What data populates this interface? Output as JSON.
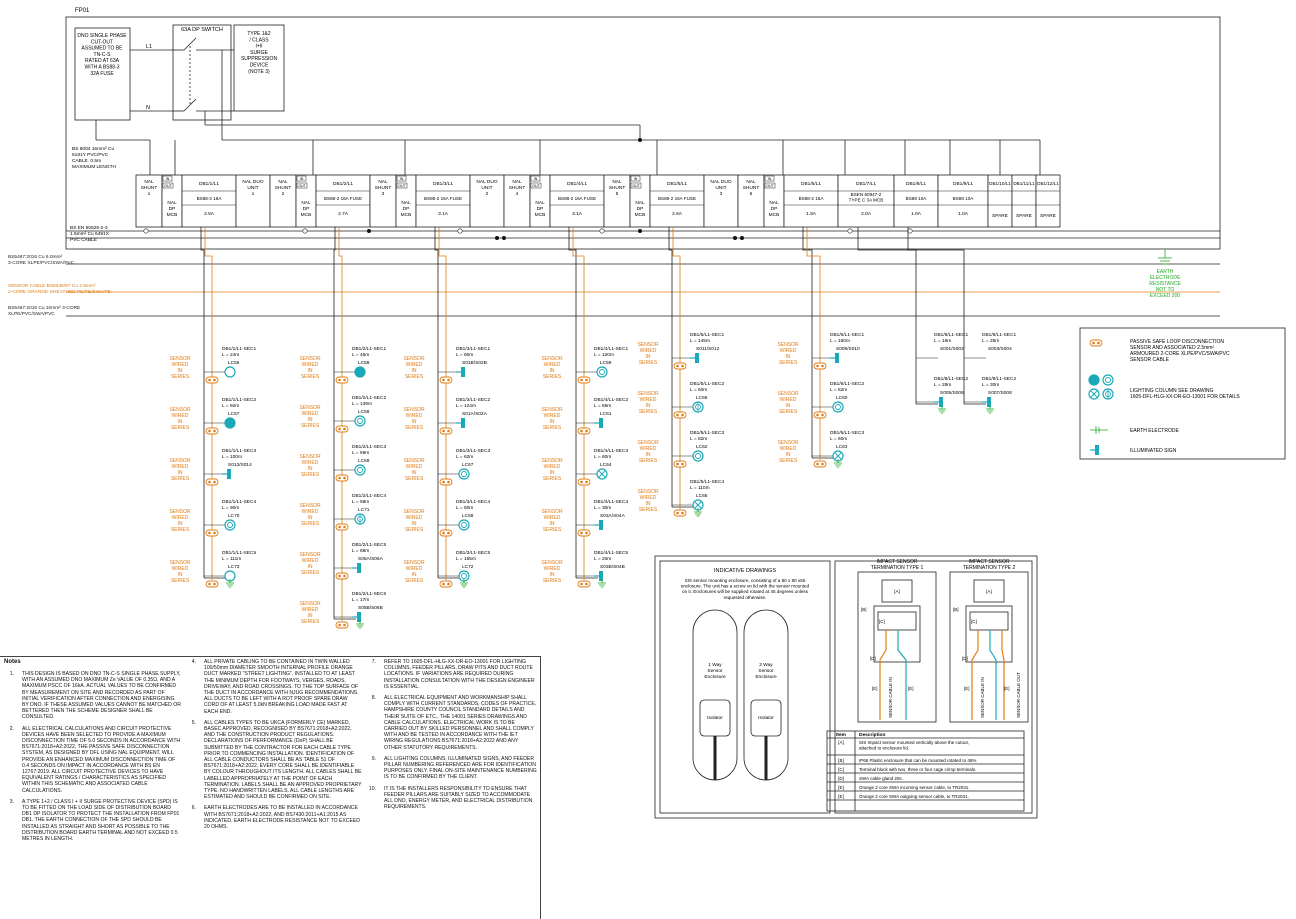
{
  "sheet_title": "FP01",
  "dno_cutout": [
    "DNO SINGLE PHASE",
    "CUT-OUT",
    "ASSUMED TO BE",
    "TN-C-S",
    "RATED AT 63A",
    "WITH A BS88-3",
    "32A FUSE"
  ],
  "phase_labels": {
    "l1": "L1",
    "n": "N"
  },
  "dp_switch_label": "63A DP SWITCH",
  "spd_box": [
    "TYPE 1&2",
    "/ CLASS",
    "I+II",
    "SURGE",
    "SUPPRESSION",
    "DEVICE",
    "(NOTE 3)"
  ],
  "earth_cable_note": [
    "BS 6004 16mm² Cu",
    "6181Y PVC/PVC",
    "CABLE. 0.5m",
    "MAXIMUM LENGTH"
  ],
  "busbar_cable_note": [
    "BS EN 50525-2-3",
    "1.5mm² Cu 6491X",
    "PVC CABLE"
  ],
  "cable_legends": [
    {
      "text": [
        "BS5467:2016 Cu 6.0mm²",
        "3-CORE XLPE/PVC/SWA/PVC"
      ],
      "color": "#222222"
    },
    {
      "text": [
        "SENSOR CABLE BS6346/97 Cu 2.5mm²",
        "2-CORE ORANGE-SHEATHED PE/PE/SWA/PE"
      ],
      "color": "#e07b12"
    },
    {
      "text": [
        "BS5467:2016 Cu 10mm² 3-CORE",
        "XLPE/PVC/SWA/PVC"
      ],
      "color": "#222222"
    }
  ],
  "board_units": [
    {
      "type": "shunt",
      "text": [
        "NAL",
        "SHUNT",
        "1"
      ]
    },
    {
      "type": "dp",
      "text": [
        "NAL",
        "DP",
        "MCB"
      ]
    },
    {
      "type": "circuit",
      "name": "DB1/1/L1",
      "device": "BS88-2 16A",
      "rating": "2.5A"
    },
    {
      "type": "duo",
      "text": [
        "NAL DUO",
        "UNIT",
        "1"
      ]
    },
    {
      "type": "shunt",
      "text": [
        "NAL",
        "SHUNT",
        "2"
      ]
    },
    {
      "type": "dp",
      "text": [
        "NAL",
        "DP",
        "MCB"
      ]
    },
    {
      "type": "circuit",
      "name": "DB1/2/L1",
      "device": "BS88-2 16A FUSE",
      "rating": "2.7A"
    },
    {
      "type": "shunt",
      "text": [
        "NAL",
        "SHUNT",
        "3"
      ]
    },
    {
      "type": "dp",
      "text": [
        "NAL",
        "DP",
        "MCB"
      ]
    },
    {
      "type": "circuit",
      "name": "DB1/3/L1",
      "device": "BS88-2 16A FUSE",
      "rating": "3.1A"
    },
    {
      "type": "duo",
      "text": [
        "NAL DUO",
        "UNIT",
        "2"
      ]
    },
    {
      "type": "shunt",
      "text": [
        "NAL",
        "SHUNT",
        "4"
      ]
    },
    {
      "type": "dp",
      "text": [
        "NAL",
        "DP",
        "MCB"
      ]
    },
    {
      "type": "circuit",
      "name": "DB1/4/L1",
      "device": "BS88-2 16A FUSE",
      "rating": "3.1A"
    },
    {
      "type": "shunt",
      "text": [
        "NAL",
        "SHUNT",
        "5"
      ]
    },
    {
      "type": "dp",
      "text": [
        "NAL",
        "DP",
        "MCB"
      ]
    },
    {
      "type": "circuit",
      "name": "DB1/5/L1",
      "device": "BS88-2 16A FUSE",
      "rating": "2.6A"
    },
    {
      "type": "duo",
      "text": [
        "NAL DUO",
        "UNIT",
        "3"
      ]
    },
    {
      "type": "shunt",
      "text": [
        "NAL",
        "SHUNT",
        "6"
      ]
    },
    {
      "type": "dp",
      "text": [
        "NAL",
        "DP",
        "MCB"
      ]
    },
    {
      "type": "circuit",
      "name": "DB1/6/L1",
      "device": "BS88-2 16A",
      "rating": "1.9A"
    },
    {
      "type": "circuit",
      "name": "DB1/7/L1",
      "device": "BSEN 60947-2 TYPE C 3A MCB",
      "rating": "2.0A"
    },
    {
      "type": "circuit",
      "name": "DB1/8/L1",
      "device": "BS88 10A",
      "rating": "1.0A"
    },
    {
      "type": "circuit",
      "name": "DB1/9/L1",
      "device": "BS88 10A",
      "rating": "1.0A"
    },
    {
      "type": "spare",
      "name": "DB1/10/L1",
      "rating": "SPARE"
    },
    {
      "type": "spare",
      "name": "DB1/11/L1",
      "rating": "SPARE"
    },
    {
      "type": "spare",
      "name": "DB1/12/L1",
      "rating": "SPARE"
    }
  ],
  "in_label": "IN",
  "out_label": "OUT",
  "sensor_wired_text": [
    "SENSOR",
    "WIRED",
    "IN",
    "SERIES"
  ],
  "circuits": [
    {
      "sections": [
        {
          "id": "DB1/1/L1-SEC1",
          "len": "L = 24m",
          "load": "LC55",
          "sym": "col1"
        },
        {
          "id": "DB1/1/L1-SEC2",
          "len": "L = 92m",
          "load": "LC57",
          "sym": "col1f"
        },
        {
          "id": "DB1/1/L1-SEC3",
          "len": "L = 100m",
          "load": "S013/S014",
          "sym": "sign"
        },
        {
          "id": "DB1/1/L1-SEC4",
          "len": "L = 90m",
          "load": "LC70",
          "sym": "col2"
        },
        {
          "id": "DB1/1/L1-SEC5",
          "len": "L = 111m",
          "load": "LC73",
          "sym": "col1"
        }
      ]
    },
    {
      "sections": [
        {
          "id": "DB1/2/L1-SEC1",
          "len": "L = 45m",
          "load": "LC56",
          "sym": "col1f"
        },
        {
          "id": "DB1/2/L1-SEC2",
          "len": "L = 139m",
          "load": "LC58",
          "sym": "col2"
        },
        {
          "id": "DB1/2/L1-SEC3",
          "len": "L = 59m",
          "load": "LC69",
          "sym": "col2"
        },
        {
          "id": "DB1/2/L1-SEC4",
          "len": "L = 58m",
          "load": "LC71",
          "sym": "col3"
        },
        {
          "id": "DB1/2/L1-SEC5",
          "len": "L = 68m",
          "load": "S05A/S06A",
          "sym": "sign"
        },
        {
          "id": "DB1/2/L1-SEC6",
          "len": "L = 17m",
          "load": "S05B/S06B",
          "sym": "sign"
        }
      ]
    },
    {
      "sections": [
        {
          "id": "DB1/3/L1-SEC1",
          "len": "L = 60m",
          "load": "S01B/S02B",
          "sym": "sign"
        },
        {
          "id": "DB1/3/L1-SEC2",
          "len": "L = 124m",
          "load": "S01A/S02A",
          "sym": "sign"
        },
        {
          "id": "DB1/3/L1-SEC3",
          "len": "L = 62m",
          "load": "LC67",
          "sym": "col2"
        },
        {
          "id": "DB1/3/L1-SEC4",
          "len": "L = 50m",
          "load": "LC68",
          "sym": "col2"
        },
        {
          "id": "DB1/3/L1-SEC5",
          "len": "L = 155m",
          "load": "LC72",
          "sym": "col2"
        }
      ]
    },
    {
      "sections": [
        {
          "id": "DB1/4/L1-SEC1",
          "len": "L = 120m",
          "load": "LC59",
          "sym": "col2"
        },
        {
          "id": "DB1/4/L1-SEC2",
          "len": "L = 65m",
          "load": "LC61",
          "sym": "sign"
        },
        {
          "id": "DB1/4/L1-SEC3",
          "len": "L = 60m",
          "load": "LC64",
          "sym": "colx"
        },
        {
          "id": "DB1/4/L1-SEC4",
          "len": "L = 30m",
          "load": "S03A/S04A",
          "sym": "sign"
        },
        {
          "id": "DB1/4/L1-SEC5",
          "len": "L = 20m",
          "load": "S03B/S04B",
          "sym": "sign"
        }
      ]
    },
    {
      "sections": [
        {
          "id": "DB1/5/L1-SEC1",
          "len": "L = 145m",
          "load": "S011/S012",
          "sym": "sign"
        },
        {
          "id": "DB1/5/L1-SEC2",
          "len": "L = 60m",
          "load": "LC66",
          "sym": "col3"
        },
        {
          "id": "DB1/5/L1-SEC3",
          "len": "L = 82m",
          "load": "LC62",
          "sym": "col2"
        },
        {
          "id": "DB1/5/L1-SEC4",
          "len": "L = 110m",
          "load": "LC65",
          "sym": "colx"
        }
      ]
    },
    {
      "sections": [
        {
          "id": "DB1/6/L1-SEC1",
          "len": "L = 160m",
          "load": "S009/S010",
          "sym": "sign"
        },
        {
          "id": "DB1/6/L1-SEC2",
          "len": "L = 52m",
          "load": "LC60",
          "sym": "col2"
        },
        {
          "id": "DB1/6/L1-SEC3",
          "len": "L = 60m",
          "load": "LC63",
          "sym": "colx"
        }
      ]
    },
    {
      "sections": [
        {
          "id": "DB1/8/L1-SEC1",
          "len": "L = 18m",
          "load": "S001/S002",
          "sym": "none"
        },
        {
          "id": "DB1/8/L1-SEC2",
          "len": "L = 28m",
          "load": "S005/S006",
          "sym": "sign"
        }
      ]
    },
    {
      "sections": [
        {
          "id": "DB1/9/L1-SEC1",
          "len": "L = 25m",
          "load": "S003/S004",
          "sym": "none"
        },
        {
          "id": "DB1/9/L1-SEC2",
          "len": "L = 30m",
          "load": "S007/S008",
          "sym": "sign"
        }
      ]
    }
  ],
  "earth_electrode_note": [
    "EARTH",
    "ELECTRODE",
    "RESISTANCE",
    "NOT TO",
    "EXCEED 200"
  ],
  "legend": {
    "passive_loop": [
      "PASSIVE SAFE LOOP DISCONNECTION",
      "SENSOR AND ASSOCIATED 2.5mm²",
      "ARMOURED 2-CORE XLPE/PVC/SWA/PVC",
      "SENSOR CABLE"
    ],
    "lighting_column": [
      "LIGHTING COLUMN SEE DRAWING",
      "1605-DFL-HLG-XX-DR-EO-13001 FOR DETAILS"
    ],
    "earth_electrode": "EARTH ELECTRODE",
    "illuminated_sign": "ILLUMINATED SIGN"
  },
  "indicative": {
    "title": "INDICATIVE DRAWINGS",
    "description": [
      "SIS sensor mounting enclosure, consisting of a 80 x 80 x55",
      "enclosure. The unit has a screw on lid with the sensor mounted",
      "on it. Enclosures will be supplied rotated at 45 degrees unless",
      "requested otherwise."
    ],
    "enclosure1": [
      "1 Way",
      "Sensor",
      "Enclosure"
    ],
    "enclosure2": [
      "2 Way",
      "Sensor",
      "Enclosure"
    ],
    "isolator": "Isolator",
    "term1_title": [
      "IMPACT SENSOR",
      "TERMINATION TYPE 1"
    ],
    "term2_title": [
      "IMPACT SENSOR",
      "TERMINATION TYPE 2"
    ],
    "tags": {
      "a": "[A]",
      "b": "[B]",
      "c": "[C]",
      "d": "[D]",
      "e": "[E]"
    },
    "cable_in": "SENSOR CABLE IN",
    "cable_out": "SENSOR CABLE OUT",
    "table_headers": [
      "Item",
      "Description"
    ],
    "table_rows": [
      [
        "[A]",
        "SIS Impact sensor mounted vertically above the cutout, attached to enclosure lid."
      ],
      [
        "[B]",
        "IP65 Plastic enclosure that can be mounted rotated to 45%"
      ],
      [
        "[C]",
        "Terminal block with two, three or four cage crimp terminals."
      ],
      [
        "[D]",
        "SWA cable gland 20s."
      ],
      [
        "[E]",
        "Orange 2 core SWA incoming sensor cable, to TR2031."
      ],
      [
        "[E]",
        "Orange 2 core SWA outgoing sensor cable, to TR2031."
      ]
    ]
  },
  "notes_title": "Notes",
  "notes": [
    {
      "num": "1.",
      "text": "THIS DESIGN IS BASED ON DNO TN-C-S SINGLE PHASE SUPPLY, WITH AN ASSUMED DNO MAXIMUM Ze VALUE OF 0.35Ω, AND A MAXIMUM PSCC OF 16kA. ACTUAL VALUES TO BE CONFIRMED BY MEASUREMENT ON SITE AND RECORDED AS PART OF INITIAL VERIFICATION AFTER CONNECTION AND ENERGISING BY DNO. IF THESE ASSUMED VALUES CANNOT BE MATCHED OR BETTERED THEN THE SCHEME DESIGNER SHALL BE CONSULTED."
    },
    {
      "num": "2.",
      "text": "ALL ELECTRICAL CALCULATIONS AND CIRCUIT PROTECTIVE DEVICES HAVE BEEN SELECTED TO PROVIDE A MAXIMUM DISCONNECTION TIME OF 5.0 SECONDS IN ACCORDANCE WITH BS7671:2018+A2:2022, THE PASSIVE SAFE DISCONNECTION SYSTEM, AS DESIGNED BY DFL USING NAL EQUIPMENT, WILL PROVIDE AN ENHANCED MAXIMUM DISCONNECTION TIME OF 0.4 SECONDS ON IMPACT IN ACCORDANCE WITH BS EN 12767:2019. ALL CIRCUIT PROTECTIVE DEVICES TO HAVE EQUIVALENT RATINGS / CHARACTERISTICS AS SPECIFIED WITHIN THIS SCHEMATIC AND ASSOCIATED CABLE CALCULATIONS."
    },
    {
      "num": "3.",
      "text": "A TYPE 1+2 / CLASS I + II SURGE PROTECTIVE DEVICE (SPD) IS TO BE FITTED ON THE LOAD SIDE OF DISTRIBUTION BOARD DB1 DP ISOLATOR TO PROTECT THE INSTALLATION FROM FP01 DB1. THE EARTH CONNECTION OF THE SPD SHOULD BE INSTALLED AS STRAIGHT AND SHORT AS POSSIBLE TO THE DISTRIBUTION BOARD EARTH TERMINAL AND NOT EXCEED 0.5 METRES IN LENGTH."
    },
    {
      "num": "4.",
      "text": "ALL PRIVATE CABLING TO BE CONTAINED IN TWIN WALLED 100/50mm DIAMETER SMOOTH INTERNAL PROFILE ORANGE DUCT MARKED \"STREET LIGHTING\", INSTALLED TO AT LEAST THE MINIMUM DEPTH FOR FOOTWAYS, VERGES, ROADS, DRIVEWAY, AND ROAD CROSSINGS. TO THE TOP SURFACE OF THE DUCT IN ACCORDANCE WITH NJUG RECOMMENDATIONS. ALL DUCTS TO BE LEFT WITH A ROT PROOF SPARE DRAW CORD OF AT LEAST 5.0kN BREAKING LOAD MADE FAST AT EACH END."
    },
    {
      "num": "5.",
      "text": "ALL CABLES TYPES TO BE UKCA (FORMERLY CE) MARKED, BASEC APPROVED, RECOGNISED BY BS7671:2018+A2:2022, AND THE CONSTRUCTION PRODUCT REGULATIONS. DECLARATIONS OF PERFORMANCE (DoP) SHALL BE SUBMITTED BY THE CONTRACTOR FOR EACH CABLE TYPE PRIOR TO COMMENCING INSTALLATION. IDENTIFICATION OF ALL CABLE CONDUCTORS SHALL BE AS TABLE 51 OF BS7671:2018+A2:2022. EVERY CORE SHALL BE IDENTIFIABLE BY COLOUR THROUGHOUT ITS LENGTH. ALL CABLES SHALL BE LABELLED APPROPRIATELY AT THE POINT OF EACH TERMINATION. LABELS SHALL BE AN APPROVED PROPRIETARY TYPE. NO HANDWRITTEN LABELS. ALL CABLE LENGTHS ARE ESTIMATED AND SHOULD BE CONFIRMED ON SITE."
    },
    {
      "num": "6.",
      "text": "EARTH ELECTRODES ARE TO BE INSTALLED IN ACCORDANCE WITH BS7671:2018+A2:2022, AND BS7430:2011+A1:2015 AS INDICATED. EARTH ELECTRODE RESISTANCE NOT TO EXCEED 20 OHMS."
    },
    {
      "num": "7.",
      "text": "REFER TO 1605-DFL-HLG-XX-DR-EO-13001 FOR LIGHTING COLUMNS, FEEDER PILLARS, DRAW PITS AND DUCT ROUTE LOCATIONS. IF VARIATIONS ARE REQUIRED DURING INSTALLATION CONSULTATION WITH THE DESIGN ENGINEER IS ESSENTIAL."
    },
    {
      "num": "8.",
      "text": "ALL ELECTRICAL EQUIPMENT AND WORKMANSHIP SHALL COMPLY WITH CURRENT STANDARDS, CODES OF PRACTICE, HAMPSHIRE COUNTY COUNCIL STANDARD DETAILS AND THEIR SUITE OF ETC., THE 14001 SERIES DRAWINGS AND CABLE CALCULATIONS. ELECTRICAL WORK IS TO BE CARRIED OUT BY SKILLED PERSONNEL AND SHALL COMPLY WITH AND BE TESTED IN ACCORDANCE WITH THE IET WIRING REGULATIONS BS7671:2018+A2:2022 AND ANY OTHER STATUTORY REQUIREMENTS."
    },
    {
      "num": "9.",
      "text": "ALL LIGHTING COLUMNS, ILLUMINATED SIGNS, AND FEEDER PILLAR NUMBERING REFERENCED ARE FOR IDENTIFICATION PURPOSES ONLY. FINAL ON-SITE MAINTENANCE NUMBERING IS TO BE CONFIRMED BY THE CLIENT."
    },
    {
      "num": "10.",
      "text": "IT IS THE INSTALLERS RESPONSIBILITY TO ENSURE THAT FEEDER PILLARS ARE SUITABLY SIZED TO ACCOMMODATE ALL DNO, ENERGY METER, AND ELECTRICAL DISTRIBUTION REQUIREMENTS."
    }
  ],
  "colors": {
    "sensor": "#e07b12",
    "equipment": "#1aa9b8",
    "earth": "#22aa22",
    "line": "#222222"
  }
}
